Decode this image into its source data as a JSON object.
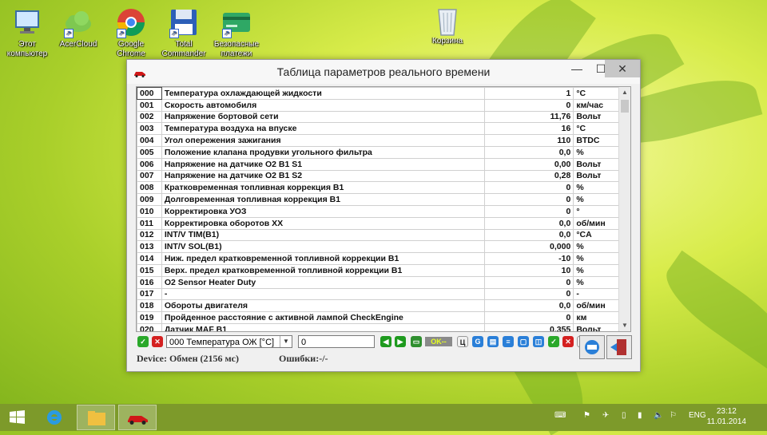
{
  "desktop": {
    "icons": [
      {
        "label": "Этот компьютер",
        "icon": "computer-icon"
      },
      {
        "label": "AcerCloud",
        "icon": "cloud-icon"
      },
      {
        "label": "Google Chrome",
        "icon": "chrome-icon"
      },
      {
        "label": "Total Commander",
        "icon": "floppy-icon"
      },
      {
        "label": "Безопасные платежи",
        "icon": "card-icon"
      },
      {
        "label": "Корзина",
        "icon": "recycle-bin-icon"
      }
    ]
  },
  "window": {
    "title": "Таблица параметров реального времени",
    "minimize": "—",
    "maximize": "☐",
    "close": "✕",
    "rows": [
      {
        "num": "000",
        "name": "Температура охлаждающей жидкости",
        "value": "1",
        "unit": "°C"
      },
      {
        "num": "001",
        "name": "Скорость автомобиля",
        "value": "0",
        "unit": "км/час"
      },
      {
        "num": "002",
        "name": "Напряжение бортовой сети",
        "value": "11,76",
        "unit": "Вольт"
      },
      {
        "num": "003",
        "name": "Температура воздуха на впуске",
        "value": "16",
        "unit": "°C"
      },
      {
        "num": "004",
        "name": "Угол опережения зажигания",
        "value": "110",
        "unit": "BTDC"
      },
      {
        "num": "005",
        "name": "Положение клапана продувки угольного фильтра",
        "value": "0,0",
        "unit": "%"
      },
      {
        "num": "006",
        "name": "Напряжение на датчике O2 B1 S1",
        "value": "0,00",
        "unit": "Вольт"
      },
      {
        "num": "007",
        "name": "Напряжение на датчике O2 B1 S2",
        "value": "0,28",
        "unit": "Вольт"
      },
      {
        "num": "008",
        "name": "Кратковременная топливная коррекция B1",
        "value": "0",
        "unit": "%"
      },
      {
        "num": "009",
        "name": "Долговременная топливная коррекция B1",
        "value": "0",
        "unit": "%"
      },
      {
        "num": "010",
        "name": "Корректировка УОЗ",
        "value": "0",
        "unit": "°"
      },
      {
        "num": "011",
        "name": "Корректировка оборотов XX",
        "value": "0,0",
        "unit": "об/мин"
      },
      {
        "num": "012",
        "name": "INT/V TIM(B1)",
        "value": "0,0",
        "unit": "°CA"
      },
      {
        "num": "013",
        "name": "INT/V SOL(B1)",
        "value": "0,000",
        "unit": "%"
      },
      {
        "num": "014",
        "name": "Ниж. предел кратковременной топливной коррекции B1",
        "value": "-10",
        "unit": "%"
      },
      {
        "num": "015",
        "name": "Верх. предел кратковременной топливной коррекции B1",
        "value": "10",
        "unit": "%"
      },
      {
        "num": "016",
        "name": "O2 Sensor Heater Duty",
        "value": "0",
        "unit": "%"
      },
      {
        "num": "017",
        "name": "-",
        "value": "0",
        "unit": "-"
      },
      {
        "num": "018",
        "name": "Обороты двигателя",
        "value": "0,0",
        "unit": "об/мин"
      },
      {
        "num": "019",
        "name": "Пройденное расстояние с активной лампой CheckEngine",
        "value": "0",
        "unit": "км"
      },
      {
        "num": "020",
        "name": "Датчик MAF B1",
        "value": "0,355",
        "unit": "Вольт"
      }
    ],
    "toolbar": {
      "param_select": "000 Температура ОЖ [°C]",
      "value_input": "0",
      "ok_label": "OK--",
      "c_label": "Ц"
    },
    "status": {
      "device": "Device:  Обмен (2156 мс)",
      "errors": "Ошибки:-/-"
    }
  },
  "taskbar": {
    "lang": "ENG",
    "time": "23:12",
    "date": "11.01.2014"
  }
}
